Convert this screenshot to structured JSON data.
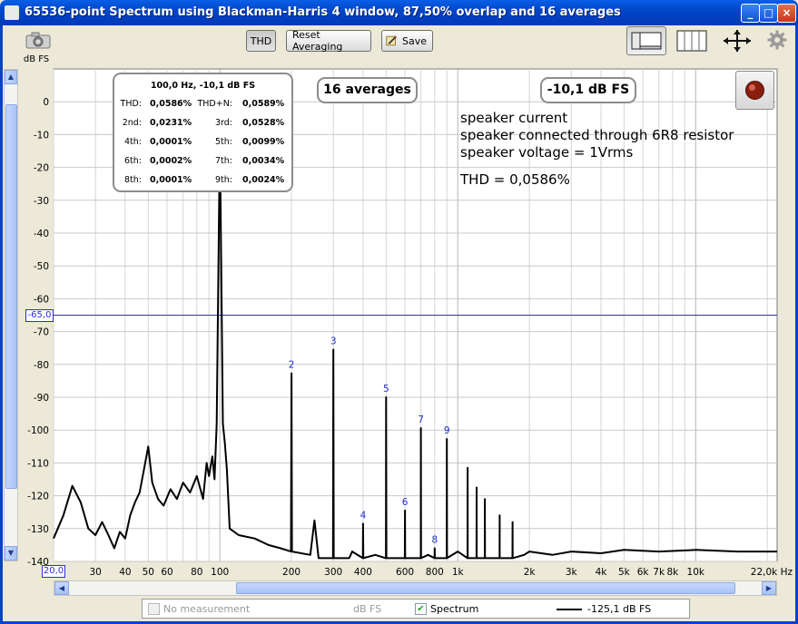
{
  "window": {
    "title": "65536-point Spectrum using Blackman-Harris 4 window, 87,50% overlap and 16 averages",
    "minimize": "_",
    "maximize": "□",
    "close": "×"
  },
  "toolbar": {
    "thd_label": "THD",
    "reset_label": "Reset Averaging",
    "save_label": "Save"
  },
  "y_unit_label": "dB FS",
  "cursor_value": "-65,0",
  "x_start_value": "20,0",
  "overlays": {
    "averages_badge": "16 averages",
    "level_badge": "-10,1 dB FS",
    "notes": [
      "speaker current",
      "speaker connected through 6R8 resistor",
      "speaker voltage = 1Vrms"
    ],
    "thd_note": "THD = 0,0586%"
  },
  "harmonics_table": {
    "header": "100,0 Hz, -10,1 dB FS",
    "rows": [
      [
        "THD:",
        "0,0586%",
        "THD+N:",
        "0,0589%"
      ],
      [
        "2nd:",
        "0,0231%",
        "3rd:",
        "0,0528%"
      ],
      [
        "4th:",
        "0,0001%",
        "5th:",
        "0,0099%"
      ],
      [
        "6th:",
        "0,0002%",
        "7th:",
        "0,0034%"
      ],
      [
        "8th:",
        "0,0001%",
        "9th:",
        "0,0024%"
      ]
    ]
  },
  "legend": {
    "no_measurement": "No measurement",
    "unit": "dB FS",
    "spectrum": "Spectrum",
    "spectrum_checked": true,
    "value": "-125,1 dB FS"
  },
  "colors": {
    "title_bar": "#0046c8",
    "plot_bg": "#ffffff",
    "grid": "#c8c8c8",
    "trace": "#000000",
    "harmonic_labels": "#1f2fcc",
    "cursor_line": "#2d2dd6"
  },
  "chart_data": {
    "type": "line",
    "title": "65536-point Spectrum using Blackman-Harris 4 window, 87,50% overlap and 16 averages",
    "xlabel": "Hz",
    "ylabel": "dB FS",
    "x_scale": "log",
    "xlim": [
      20,
      22000
    ],
    "ylim": [
      -140,
      10
    ],
    "grid": true,
    "x_ticks": [
      {
        "v": 30,
        "t": "30"
      },
      {
        "v": 40,
        "t": "40"
      },
      {
        "v": 50,
        "t": "50"
      },
      {
        "v": 60,
        "t": "60"
      },
      {
        "v": 80,
        "t": "80"
      },
      {
        "v": 100,
        "t": "100"
      },
      {
        "v": 200,
        "t": "200"
      },
      {
        "v": 300,
        "t": "300"
      },
      {
        "v": 400,
        "t": "400"
      },
      {
        "v": 600,
        "t": "600"
      },
      {
        "v": 800,
        "t": "800"
      },
      {
        "v": 1000,
        "t": "1k"
      },
      {
        "v": 2000,
        "t": "2k"
      },
      {
        "v": 3000,
        "t": "3k"
      },
      {
        "v": 4000,
        "t": "4k"
      },
      {
        "v": 5000,
        "t": "5k"
      },
      {
        "v": 6000,
        "t": "6k"
      },
      {
        "v": 7000,
        "t": "7k"
      },
      {
        "v": 8000,
        "t": "8k"
      },
      {
        "v": 10000,
        "t": "10k"
      },
      {
        "v": 22000,
        "t": "22,0k Hz"
      }
    ],
    "y_ticks": [
      0,
      -10,
      -20,
      -30,
      -40,
      -50,
      -60,
      -70,
      -80,
      -90,
      -100,
      -110,
      -120,
      -130,
      -140
    ],
    "cursor_level": -65,
    "series": [
      {
        "values": [
          [
            20,
            -133
          ],
          [
            22,
            -126
          ],
          [
            24,
            -117
          ],
          [
            26,
            -122
          ],
          [
            28,
            -130
          ],
          [
            30,
            -132
          ],
          [
            32,
            -128
          ],
          [
            34,
            -132
          ],
          [
            36,
            -136
          ],
          [
            38,
            -131
          ],
          [
            40,
            -133
          ],
          [
            42,
            -126
          ],
          [
            44,
            -122
          ],
          [
            46,
            -119
          ],
          [
            48,
            -112
          ],
          [
            50,
            -105
          ],
          [
            52,
            -116
          ],
          [
            55,
            -121
          ],
          [
            58,
            -123
          ],
          [
            62,
            -118
          ],
          [
            66,
            -121
          ],
          [
            70,
            -116
          ],
          [
            75,
            -119
          ],
          [
            80,
            -114
          ],
          [
            85,
            -121
          ],
          [
            88,
            -110
          ],
          [
            90,
            -114
          ],
          [
            93,
            -108
          ],
          [
            95,
            -115
          ],
          [
            97,
            -98
          ],
          [
            99,
            -40
          ],
          [
            100,
            -10.1
          ],
          [
            101,
            -40
          ],
          [
            103,
            -98
          ],
          [
            105,
            -104
          ],
          [
            107,
            -112
          ],
          [
            110,
            -130
          ],
          [
            120,
            -132
          ],
          [
            140,
            -133
          ],
          [
            160,
            -135
          ],
          [
            180,
            -136
          ],
          [
            199,
            -137
          ],
          [
            200,
            -82.7
          ],
          [
            201,
            -137
          ],
          [
            240,
            -138
          ],
          [
            250,
            -127.5
          ],
          [
            260,
            -139
          ],
          [
            299,
            -139
          ],
          [
            300,
            -75.5
          ],
          [
            301,
            -139
          ],
          [
            350,
            -139
          ],
          [
            360,
            -137
          ],
          [
            399,
            -139
          ],
          [
            400,
            -128.5
          ],
          [
            401,
            -139
          ],
          [
            450,
            -138
          ],
          [
            499,
            -139
          ],
          [
            500,
            -90
          ],
          [
            501,
            -139
          ],
          [
            550,
            -139
          ],
          [
            599,
            -139
          ],
          [
            600,
            -124.5
          ],
          [
            601,
            -139
          ],
          [
            650,
            -139
          ],
          [
            699,
            -139
          ],
          [
            700,
            -99.4
          ],
          [
            701,
            -139
          ],
          [
            750,
            -138
          ],
          [
            799,
            -139
          ],
          [
            800,
            -136
          ],
          [
            801,
            -139
          ],
          [
            850,
            -139
          ],
          [
            899,
            -139
          ],
          [
            900,
            -102.7
          ],
          [
            901,
            -139
          ],
          [
            1000,
            -137
          ],
          [
            1099,
            -139
          ],
          [
            1100,
            -111.5
          ],
          [
            1101,
            -139
          ],
          [
            1199,
            -139
          ],
          [
            1200,
            -117.5
          ],
          [
            1201,
            -139
          ],
          [
            1299,
            -139
          ],
          [
            1300,
            -121
          ],
          [
            1301,
            -139
          ],
          [
            1499,
            -139
          ],
          [
            1500,
            -126
          ],
          [
            1501,
            -139
          ],
          [
            1699,
            -139
          ],
          [
            1700,
            -128
          ],
          [
            1701,
            -139
          ],
          [
            1900,
            -138
          ],
          [
            2000,
            -137
          ],
          [
            2500,
            -138
          ],
          [
            3000,
            -137
          ],
          [
            4000,
            -137.5
          ],
          [
            5000,
            -136.5
          ],
          [
            7000,
            -137
          ],
          [
            10000,
            -136.5
          ],
          [
            15000,
            -137
          ],
          [
            22000,
            -137
          ]
        ]
      }
    ],
    "annotations": [
      {
        "x": 200,
        "y": -82.7,
        "text": "2"
      },
      {
        "x": 300,
        "y": -75.5,
        "text": "3"
      },
      {
        "x": 400,
        "y": -128.5,
        "text": "4"
      },
      {
        "x": 500,
        "y": -90,
        "text": "5"
      },
      {
        "x": 600,
        "y": -124.5,
        "text": "6"
      },
      {
        "x": 700,
        "y": -99.4,
        "text": "7"
      },
      {
        "x": 800,
        "y": -136,
        "text": "8"
      },
      {
        "x": 900,
        "y": -102.7,
        "text": "9"
      }
    ]
  }
}
